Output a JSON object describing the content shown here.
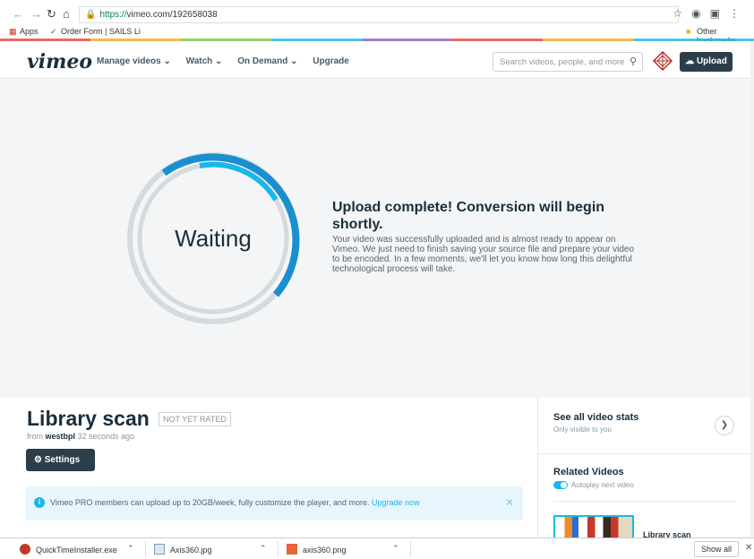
{
  "browser": {
    "url_scheme": "https://",
    "url_rest": "vimeo.com/192658038",
    "bookmarks": [
      "Apps",
      "Order Form | SAILS Li"
    ],
    "other_bookmarks": "Other bookmarks"
  },
  "header": {
    "logo": "vimeo",
    "nav": [
      "Manage videos ⌄",
      "Watch ⌄",
      "On Demand ⌄",
      "Upgrade"
    ],
    "search_placeholder": "Search videos, people, and more",
    "upload_label": "Upload"
  },
  "stage": {
    "status": "Waiting",
    "title": "Upload complete! Conversion will begin shortly.",
    "body": "Your video was successfully uploaded and is almost ready to appear on Vimeo. We just need to finish saving your source file and prepare your video to be encoded. In a few moments, we'll let you know how long this delightful technological process will take."
  },
  "video": {
    "title": "Library scan",
    "rating": "NOT YET RATED",
    "from": "from",
    "user": "westbpl",
    "time": "32 seconds ago",
    "settings_label": "Settings",
    "promo_text": "Vimeo PRO members can upload up to 20GB/week, fully customize the player, and more.",
    "promo_link": "Upgrade now"
  },
  "sidebar": {
    "stats_title": "See all video stats",
    "stats_sub": "Only visible to you",
    "related_title": "Related Videos",
    "autoplay": "Autoplay next video",
    "related_item": "Library scan"
  },
  "downloads": {
    "items": [
      "QuickTimeInstaller.exe",
      "Axis360.jpg",
      "axis360.png"
    ],
    "show_all": "Show all"
  },
  "colors": {
    "accent": "#1ab7ea",
    "dark": "#1a2e3b",
    "button": "#2d3e4b"
  }
}
